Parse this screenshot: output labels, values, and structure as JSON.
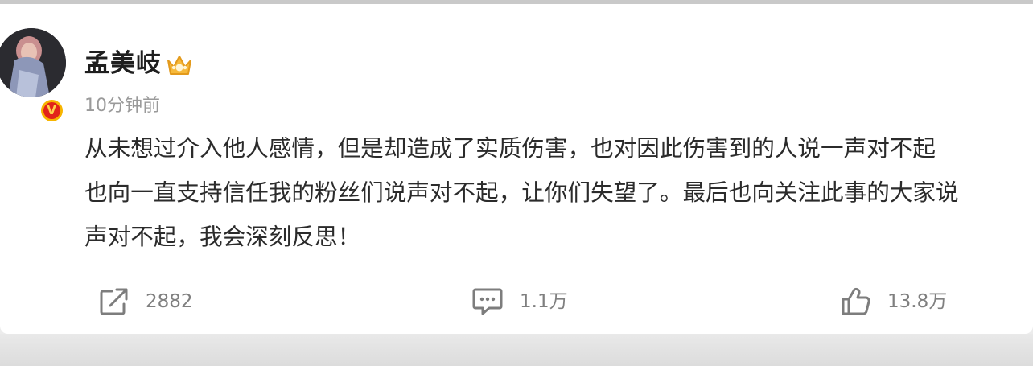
{
  "post": {
    "username": "孟美岐",
    "timestamp": "10分钟前",
    "content_lines": [
      "从未想过介入他人感情，但是却造成了实质伤害，也对因此伤害到的人说一声对不起",
      "也向一直支持信任我的粉丝们说声对不起，让你们失望了。最后也向关注此事的大家说",
      "声对不起，我会深刻反思！"
    ]
  },
  "actions": {
    "share_count": "2882",
    "comment_count": "1.1万",
    "like_count": "13.8万"
  },
  "icons": {
    "verified": "verified-v-icon",
    "member": "crown-member-icon",
    "share": "share-icon",
    "comment": "comment-icon",
    "like": "thumbs-up-icon"
  },
  "colors": {
    "verified_red": "#e2231a",
    "verified_gold": "#f7b500",
    "text": "#2b2b2b",
    "muted": "#9a9a9a"
  }
}
